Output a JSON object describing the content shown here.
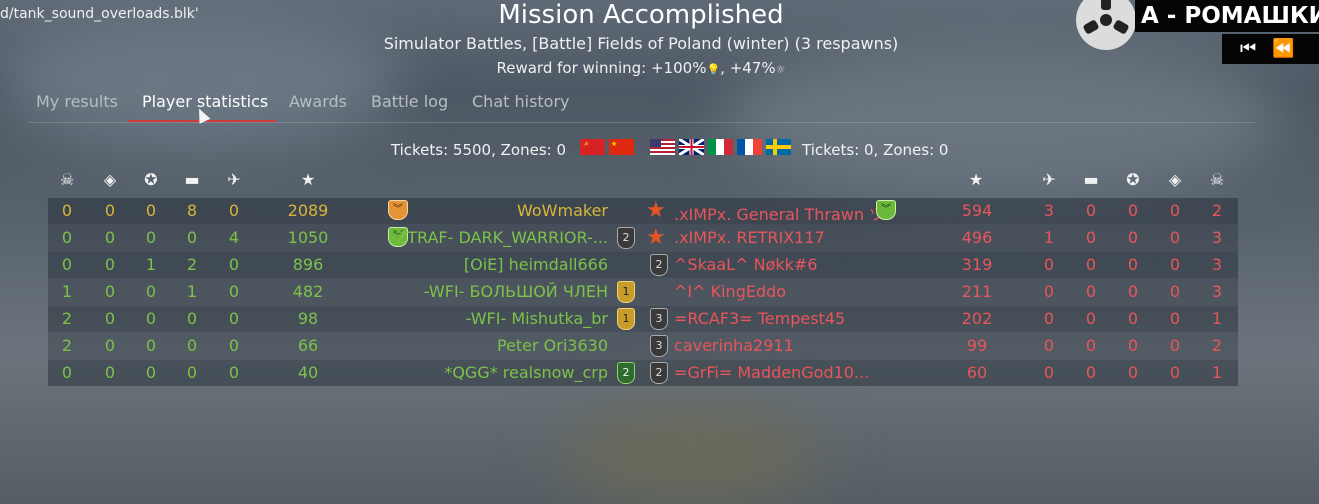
{
  "top_path": "d/tank_sound_overloads.blk'",
  "header": {
    "title": "Mission Accomplished",
    "subtitle": "Simulator Battles, [Battle] Fields of Poland (winter) (3 respawns)",
    "reward_text": "Reward for winning: +100%",
    "reward_text2": ", +47%"
  },
  "tabs": [
    {
      "label": "My results"
    },
    {
      "label": "Player statistics"
    },
    {
      "label": "Awards"
    },
    {
      "label": "Battle log"
    },
    {
      "label": "Chat history"
    }
  ],
  "tickets": {
    "left": "Tickets: 5500, Zones: 0",
    "right": "Tickets: 0, Zones: 0"
  },
  "music": {
    "title": "А - РОМАШКИ"
  },
  "left_team": [
    {
      "deaths": "0",
      "captures": "0",
      "assists": "0",
      "ground": "8",
      "air": "0",
      "score": "2089",
      "name": "WoWmaker",
      "color": "l",
      "rank": "",
      "badge": "orange"
    },
    {
      "deaths": "0",
      "captures": "0",
      "assists": "0",
      "ground": "0",
      "air": "4",
      "score": "1050",
      "name": "-ZTRAF- DARK_WARRIOR-...",
      "color": "g",
      "rank": "2",
      "badge": "green"
    },
    {
      "deaths": "0",
      "captures": "0",
      "assists": "1",
      "ground": "2",
      "air": "0",
      "score": "896",
      "name": "[OiE] heimdall666",
      "color": "g",
      "rank": "",
      "badge": ""
    },
    {
      "deaths": "1",
      "captures": "0",
      "assists": "0",
      "ground": "1",
      "air": "0",
      "score": "482",
      "name": "-WFI- БОЛЬШОЙ ЧЛЕН",
      "color": "g",
      "rank": "1",
      "badge": ""
    },
    {
      "deaths": "2",
      "captures": "0",
      "assists": "0",
      "ground": "0",
      "air": "0",
      "score": "98",
      "name": "-WFI- Mishutka_br",
      "color": "g",
      "rank": "1",
      "badge": ""
    },
    {
      "deaths": "2",
      "captures": "0",
      "assists": "0",
      "ground": "0",
      "air": "0",
      "score": "66",
      "name": "Peter Ori3630",
      "color": "g",
      "rank": "",
      "badge": ""
    },
    {
      "deaths": "0",
      "captures": "0",
      "assists": "0",
      "ground": "0",
      "air": "0",
      "score": "40",
      "name": "*QGG* realsnow_crp",
      "color": "g",
      "rank": "2",
      "badge": ""
    }
  ],
  "right_team": [
    {
      "name": ".xIMPx. General Thrawn ツ",
      "score": "594",
      "air": "3",
      "ground": "0",
      "assists": "0",
      "captures": "0",
      "deaths": "2",
      "rank": "",
      "badge": "star"
    },
    {
      "name": ".xIMPx. RETRIX117",
      "score": "496",
      "air": "1",
      "ground": "0",
      "assists": "0",
      "captures": "0",
      "deaths": "3",
      "rank": "",
      "badge": "star"
    },
    {
      "name": "^SkaaL^ Nøkk#6",
      "score": "319",
      "air": "0",
      "ground": "0",
      "assists": "0",
      "captures": "0",
      "deaths": "3",
      "rank": "2",
      "badge": ""
    },
    {
      "name": "^I^ KingEddo",
      "score": "211",
      "air": "0",
      "ground": "0",
      "assists": "0",
      "captures": "0",
      "deaths": "3",
      "rank": "",
      "badge": ""
    },
    {
      "name": "=RCAF3= Tempest45",
      "score": "202",
      "air": "0",
      "ground": "0",
      "assists": "0",
      "captures": "0",
      "deaths": "1",
      "rank": "3",
      "badge": ""
    },
    {
      "name": "caverinha2911",
      "score": "99",
      "air": "0",
      "ground": "0",
      "assists": "0",
      "captures": "0",
      "deaths": "2",
      "rank": "3",
      "badge": ""
    },
    {
      "name": "=GrFi= MaddenGod10...",
      "score": "60",
      "air": "0",
      "ground": "0",
      "assists": "0",
      "captures": "0",
      "deaths": "1",
      "rank": "2",
      "badge": ""
    }
  ],
  "colors": {
    "left_gold": "#d8b53a",
    "left_green": "#7cc24a",
    "right_red": "#e8555a",
    "tab_underline": "#d13b3b"
  }
}
